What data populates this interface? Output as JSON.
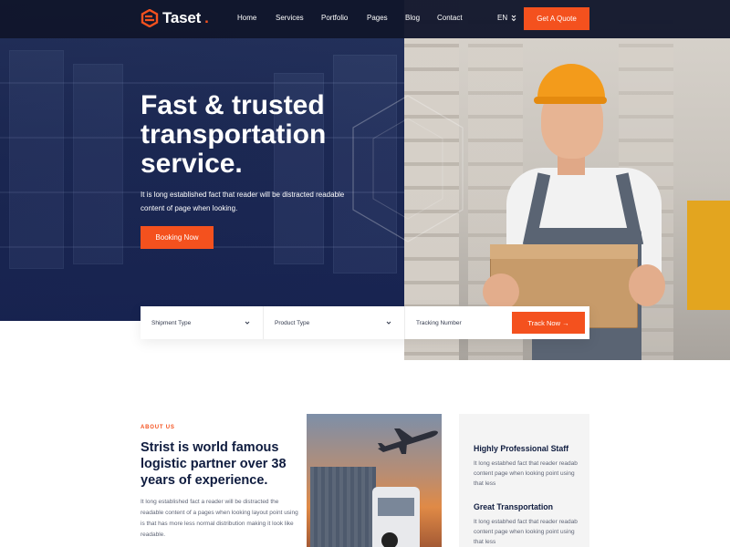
{
  "brand": {
    "name": "Taset",
    "dot": ".",
    "accent": "#f4511e",
    "dark": "#0f1c3f"
  },
  "nav": {
    "items": [
      "Home",
      "Services",
      "Portfolio",
      "Pages",
      "Blog",
      "Contact"
    ],
    "lang": "EN",
    "quote_label": "Get A Quote"
  },
  "hero": {
    "title_lines": [
      "Fast & trusted",
      "transportation",
      "service."
    ],
    "subtitle": "It is long established fact that reader will be distracted readable content of page when looking.",
    "booking_label": "Booking Now"
  },
  "tracking": {
    "shipment_label": "Shipment Type",
    "product_label": "Product Type",
    "tracking_placeholder": "Tracking Number",
    "track_label": "Track Now →"
  },
  "about": {
    "tag": "ABOUT US",
    "title": "Strist is world famous logistic partner over 38 years of experience.",
    "text": "It long established fact a reader will be distracted the readable content of a pages when looking layout point using is that has more less normal distribution making it look like readable."
  },
  "features": [
    {
      "title": "Highly Professional Staff",
      "text": "It long estabhed fact that reader readab content page when looking point using that less"
    },
    {
      "title": "Great Transportation",
      "text": "It long estabhed fact that reader readab content page when looking point using that less"
    }
  ],
  "icons": {
    "logo": "hexagon-arrow-logo-icon",
    "lang_dropdown": "double-chevron-down-icon",
    "select": "chevron-down-icon",
    "plane": "airplane-icon"
  }
}
